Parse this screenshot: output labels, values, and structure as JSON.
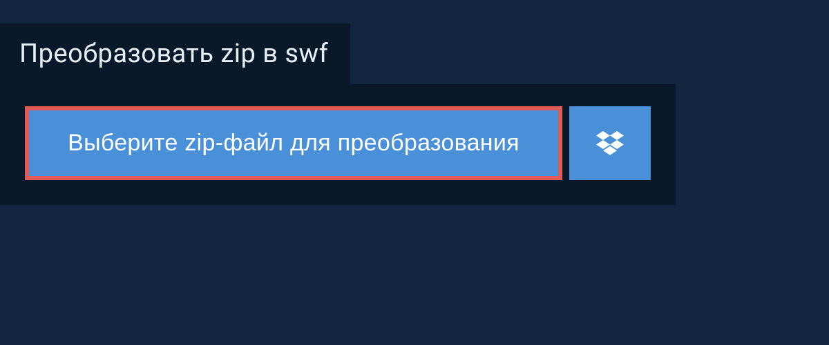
{
  "header": {
    "title": "Преобразовать zip в swf"
  },
  "actions": {
    "select_file_label": "Выберите zip-файл для преобразования"
  }
}
